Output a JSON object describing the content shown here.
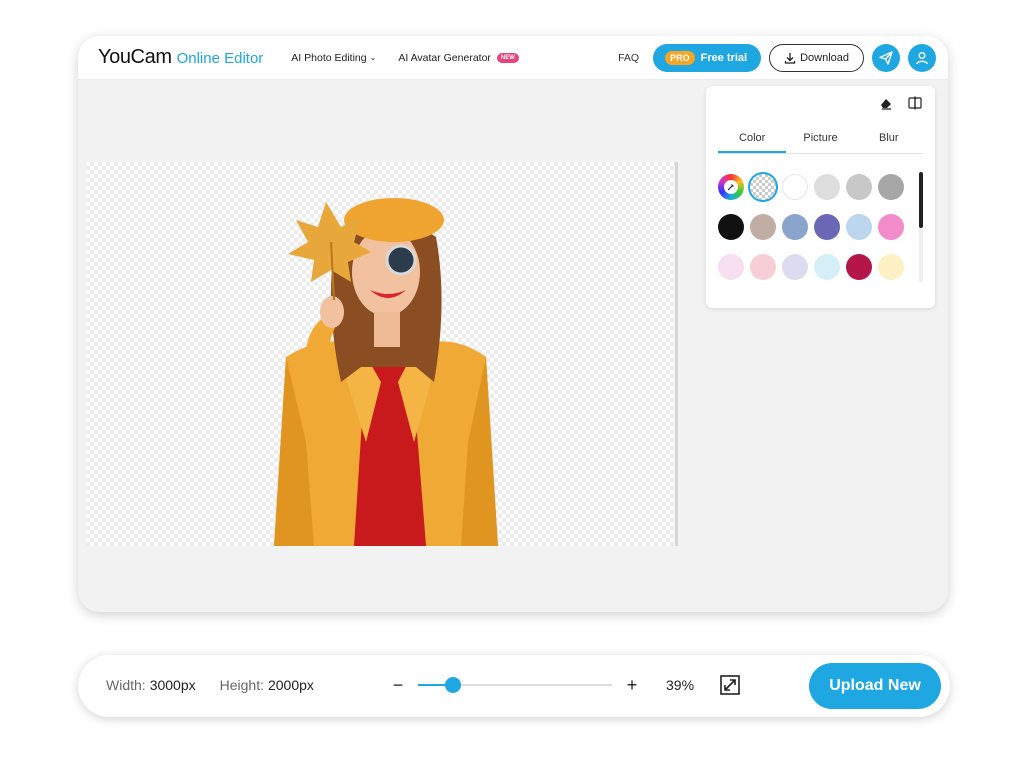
{
  "header": {
    "logo_main": "YouCam",
    "logo_sub": "Online Editor",
    "nav": [
      {
        "label": "AI Photo Editing",
        "has_dropdown": true
      },
      {
        "label": "AI Avatar Generator",
        "badge": "NEW"
      }
    ],
    "faq": "FAQ",
    "trial_pro": "PRO",
    "trial_label": "Free trial",
    "download_label": "Download",
    "icons": [
      "send-icon",
      "user-icon"
    ]
  },
  "panel": {
    "tools": [
      "eraser-icon",
      "compare-icon"
    ],
    "tabs": [
      "Color",
      "Picture",
      "Blur"
    ],
    "active_tab": "Color",
    "swatches": [
      {
        "name": "color-picker",
        "color": "picker"
      },
      {
        "name": "transparent",
        "color": "transparent",
        "selected": true
      },
      {
        "name": "white",
        "color": "#ffffff"
      },
      {
        "name": "light-gray",
        "color": "#dddddd"
      },
      {
        "name": "gray",
        "color": "#c8c8c8"
      },
      {
        "name": "dark-gray",
        "color": "#a6a6a6"
      },
      {
        "name": "black",
        "color": "#111111"
      },
      {
        "name": "taupe",
        "color": "#c0ada4"
      },
      {
        "name": "steel-blue",
        "color": "#8aa4cb"
      },
      {
        "name": "indigo",
        "color": "#6a68b5"
      },
      {
        "name": "light-blue",
        "color": "#bcd6ee"
      },
      {
        "name": "pink",
        "color": "#f28bc9"
      },
      {
        "name": "lavender-blush",
        "color": "#f7dff2"
      },
      {
        "name": "blush",
        "color": "#f6cfd6"
      },
      {
        "name": "lavender",
        "color": "#dcdcf0"
      },
      {
        "name": "pale-cyan",
        "color": "#d5eef8"
      },
      {
        "name": "crimson",
        "color": "#b5164a"
      },
      {
        "name": "cream",
        "color": "#fdf0c4"
      }
    ]
  },
  "footer": {
    "width_label": "Width:",
    "width_value": "3000px",
    "height_label": "Height:",
    "height_value": "2000px",
    "zoom_minus": "−",
    "zoom_plus": "+",
    "zoom_value": "39%",
    "zoom_fraction": 0.18,
    "upload_label": "Upload New"
  },
  "colors": {
    "accent": "#1ea7e1",
    "pro": "#f5a623",
    "new_badge": "#e8437a"
  }
}
